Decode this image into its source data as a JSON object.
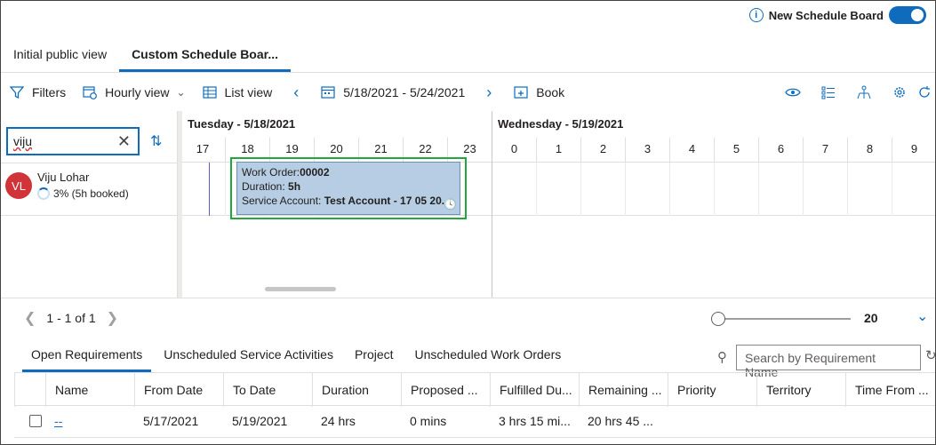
{
  "header": {
    "new_schedule_board_label": "New Schedule Board",
    "toggle_on": true
  },
  "board_tabs": [
    {
      "label": "Initial public view"
    },
    {
      "label": "Custom Schedule Boar..."
    }
  ],
  "toolbar": {
    "filters": "Filters",
    "hourly_view": "Hourly view",
    "list_view": "List view",
    "date_range": "5/18/2021 - 5/24/2021",
    "book": "Book"
  },
  "resource_panel": {
    "search_value": "viju",
    "resource": {
      "initials": "VL",
      "name": "Viju Lohar",
      "utilization": "3% (5h booked)"
    }
  },
  "timeline": {
    "day1": "Tuesday - 5/18/2021",
    "day2": "Wednesday - 5/19/2021",
    "hours": [
      "17",
      "18",
      "19",
      "20",
      "21",
      "22",
      "23",
      "0",
      "1",
      "2",
      "3",
      "4",
      "5",
      "6",
      "7",
      "8",
      "9"
    ],
    "booking": {
      "work_order_label": "Work Order:",
      "work_order": "00002",
      "duration_label": "Duration: ",
      "duration": "5h",
      "service_account_label": "Service Account: ",
      "service_account": "Test Account - 17 05 20..."
    }
  },
  "pager": {
    "text": "1 - 1 of 1",
    "zoom_value": "20"
  },
  "requirements": {
    "tabs": [
      "Open Requirements",
      "Unscheduled Service Activities",
      "Project",
      "Unscheduled Work Orders"
    ],
    "search_placeholder": "Search by Requirement Name",
    "columns": [
      "Name",
      "From Date",
      "To Date",
      "Duration",
      "Proposed ...",
      "Fulfilled Du...",
      "Remaining ...",
      "Priority",
      "Territory",
      "Time From ..."
    ],
    "rows": [
      {
        "name": "--",
        "from_date": "5/17/2021",
        "to_date": "5/19/2021",
        "duration": "24 hrs",
        "proposed": "0 mins",
        "fulfilled": "3 hrs 15 mi...",
        "remaining": "20 hrs 45 ...",
        "priority": "",
        "territory": "",
        "time_from": ""
      }
    ]
  },
  "colors": {
    "accent": "#0f6cbd",
    "booking_fill": "#b7cde3",
    "highlight_outline": "#22a73c",
    "avatar": "#d13438"
  }
}
